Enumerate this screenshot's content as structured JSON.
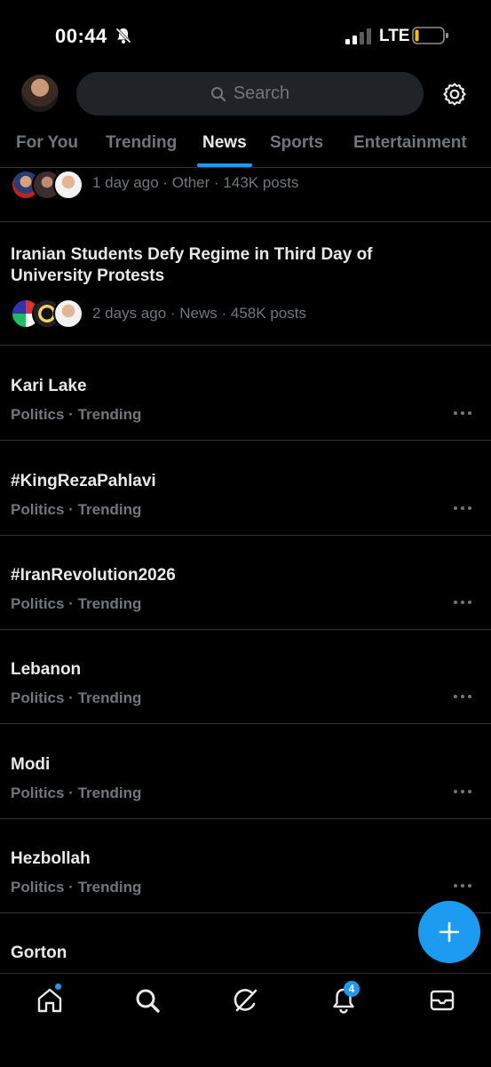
{
  "status_bar": {
    "time": "00:44",
    "network": "LTE"
  },
  "header": {
    "search_placeholder": "Search"
  },
  "tabs": [
    {
      "label": "For You",
      "active": false
    },
    {
      "label": "Trending",
      "active": false
    },
    {
      "label": "News",
      "active": true
    },
    {
      "label": "Sports",
      "active": false
    },
    {
      "label": "Entertainment",
      "active": false
    }
  ],
  "news": [
    {
      "title": "",
      "meta": "1 day ago · Other · 143K posts"
    },
    {
      "title": "Iranian Students Defy Regime in Third Day of University Protests",
      "meta": "2 days ago · News · 458K posts"
    }
  ],
  "trends": [
    {
      "name": "Kari Lake",
      "context": "Politics · Trending"
    },
    {
      "name": "#KingRezaPahlavi",
      "context": "Politics · Trending"
    },
    {
      "name": "#IranRevolution2026",
      "context": "Politics · Trending"
    },
    {
      "name": "Lebanon",
      "context": "Politics · Trending"
    },
    {
      "name": "Modi",
      "context": "Politics · Trending"
    },
    {
      "name": "Hezbollah",
      "context": "Politics · Trending"
    },
    {
      "name": "Gorton",
      "context": ""
    }
  ],
  "bottom_nav": {
    "notifications_count": "4",
    "items": [
      "home-icon",
      "search-icon",
      "grok-icon",
      "bell-icon",
      "mail-icon"
    ]
  },
  "colors": {
    "accent": "#1d9bf0",
    "background": "#000000",
    "text_primary": "#e7e9ea",
    "text_secondary": "#71767b"
  }
}
